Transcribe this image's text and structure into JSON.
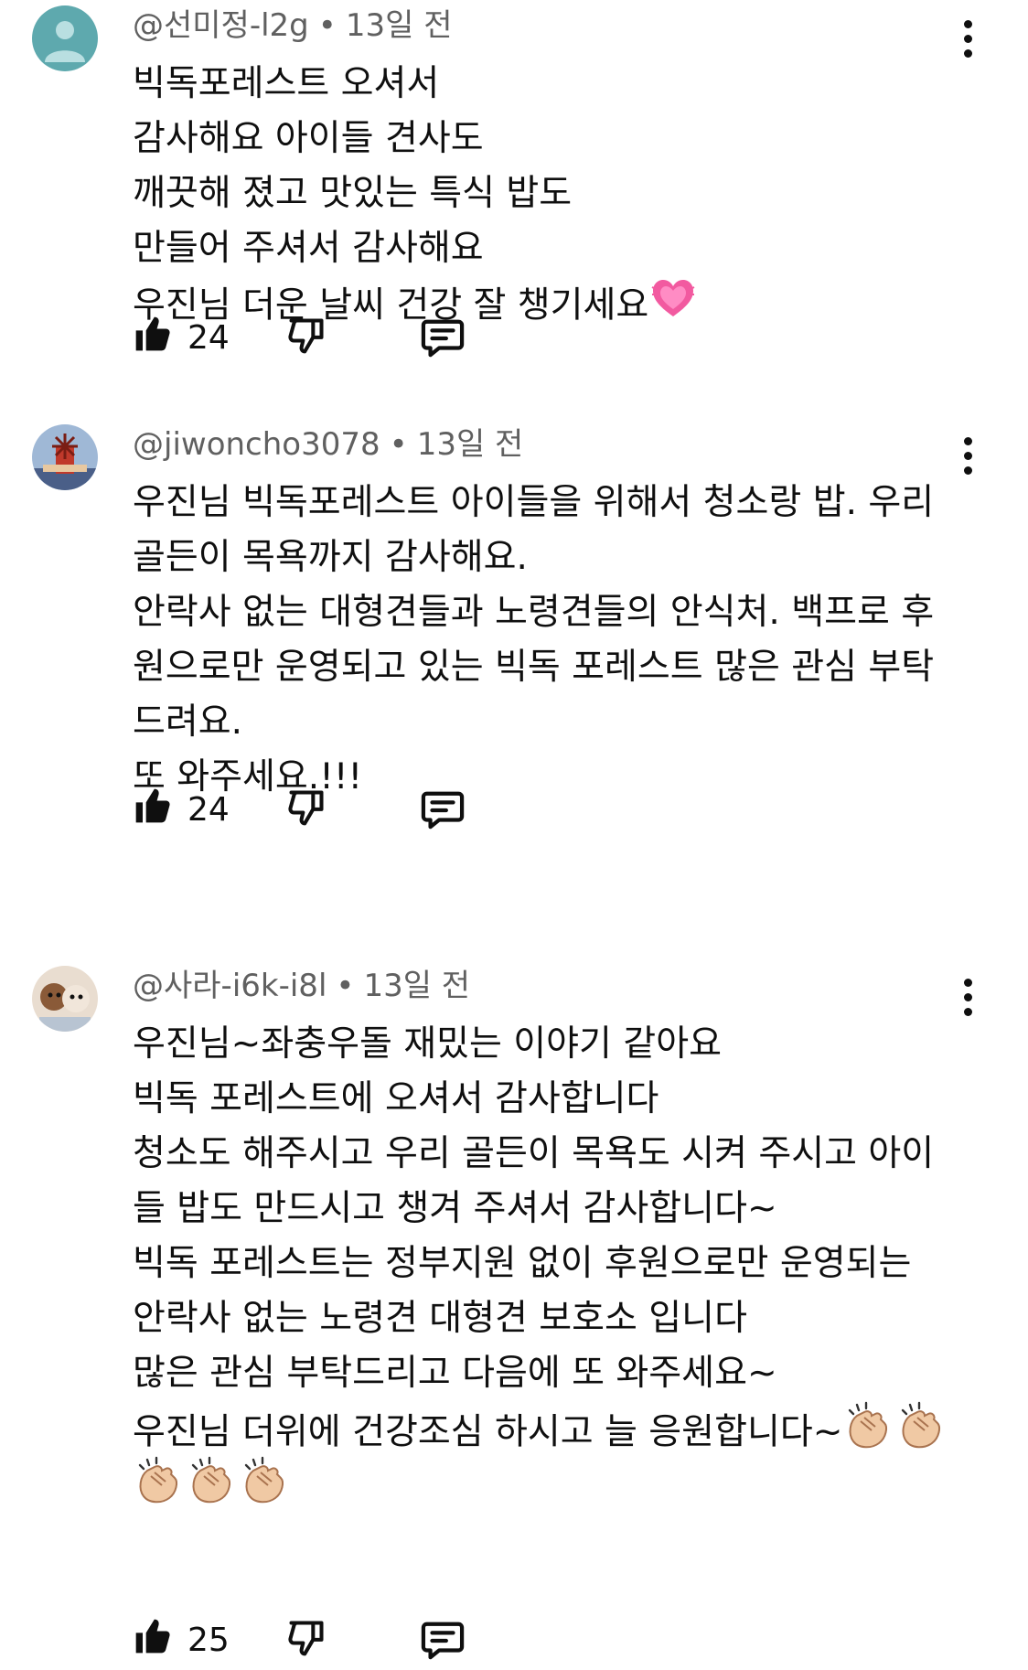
{
  "comments": [
    {
      "author": "@선미정-l2g",
      "separator": "•",
      "time": "13일 전",
      "lines": [
        "빅독포레스트 오셔서",
        "감사해요 아이들 견사도",
        "깨끗해 졌고 맛있는 특식 밥도",
        "만들어 주셔서 감사해요",
        "우진님 더운 날씨 건강 잘 챙기세요"
      ],
      "likes": "24"
    },
    {
      "author": "@jiwoncho3078",
      "separator": "•",
      "time": "13일 전",
      "lines": [
        "우진님 빅독포레스트 아이들을 위해서 청소랑 밥. 우리",
        "골든이 목욕까지 감사해요.",
        "안락사 없는 대형견들과 노령견들의 안식처. 백프로 후",
        "원으로만 운영되고 있는 빅독 포레스트 많은 관심 부탁",
        "드려요.",
        "또 와주세요.!!!"
      ],
      "likes": "24"
    },
    {
      "author": "@사라-i6k-i8l",
      "separator": "•",
      "time": "13일 전",
      "lines": [
        "우진님~좌충우돌 재밌는 이야기 같아요",
        "빅독 포레스트에 오셔서 감사합니다",
        "청소도 해주시고 우리 골든이 목욕도 시켜 주시고 아이",
        "들 밥도 만드시고 챙겨 주셔서 감사합니다~",
        "빅독 포레스트는 정부지원 없이 후원으로만 운영되는",
        "안락사 없는 노령견 대형견 보호소 입니다",
        "많은 관심 부탁드리고 다음에 또 와주세요~",
        "우진님 더위에 건강조심 하시고 늘 응원합니다~"
      ],
      "likes": "25"
    }
  ],
  "icons": {
    "like": "thumbs-up-icon",
    "dislike": "thumbs-down-icon",
    "reply": "reply-icon",
    "menu": "more-vert-icon",
    "heart": "growing-heart-emoji",
    "clap": "clapping-hands-emoji"
  },
  "colors": {
    "text": "#0f0f0f",
    "meta": "#606060",
    "heart": "#f25aa0",
    "clap": "#f0c9a4"
  }
}
